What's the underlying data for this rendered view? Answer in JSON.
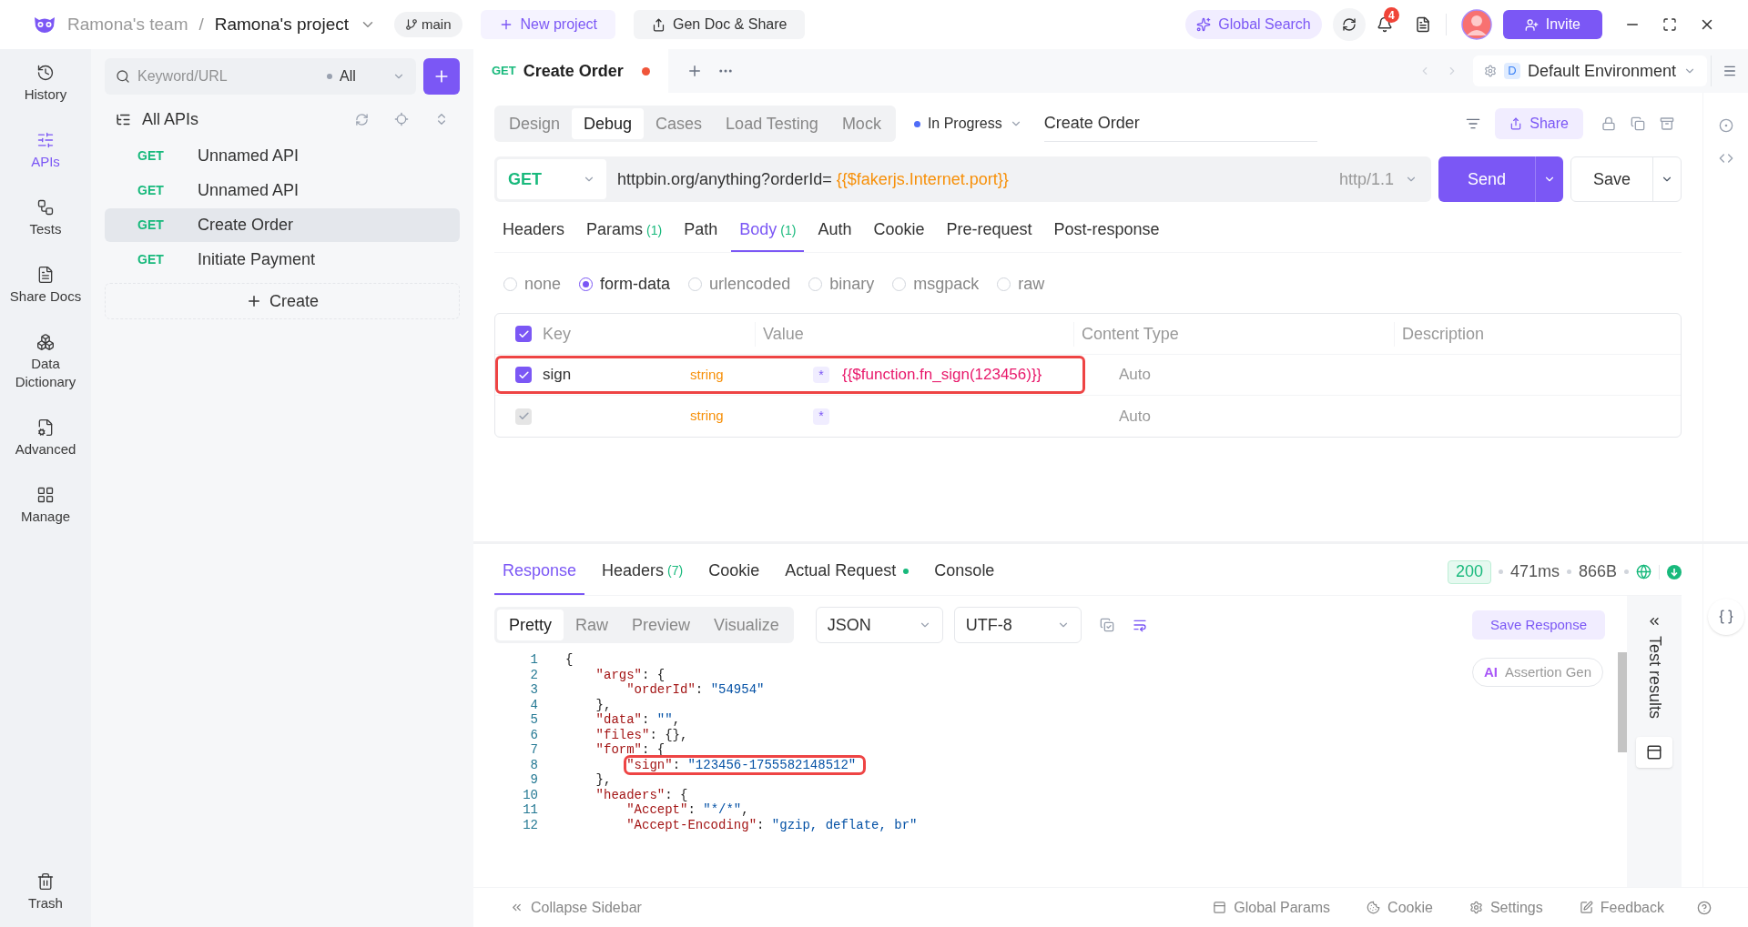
{
  "topbar": {
    "team": "Ramona's team",
    "separator": "/",
    "project": "Ramona's project",
    "branch": "main",
    "new_project": "New project",
    "gen_doc": "Gen Doc & Share",
    "global_search": "Global Search",
    "notifications": "4",
    "invite": "Invite"
  },
  "nav": [
    {
      "label": "History",
      "selected": false
    },
    {
      "label": "APIs",
      "selected": true
    },
    {
      "label": "Tests",
      "selected": false
    },
    {
      "label": "Share Docs",
      "selected": false
    },
    {
      "label": "Data Dictionary",
      "selected": false
    },
    {
      "label": "Advanced",
      "selected": false
    },
    {
      "label": "Manage",
      "selected": false
    },
    {
      "label": "Trash",
      "selected": false
    }
  ],
  "api_list": {
    "search_placeholder": "Keyword/URL",
    "filter": "All",
    "title": "All APIs",
    "create": "Create",
    "items": [
      {
        "method": "GET",
        "name": "Unnamed API",
        "selected": false
      },
      {
        "method": "GET",
        "name": "Unnamed API",
        "selected": false
      },
      {
        "method": "GET",
        "name": "Create Order",
        "selected": true
      },
      {
        "method": "GET",
        "name": "Initiate Payment",
        "selected": false
      }
    ]
  },
  "tab": {
    "method": "GET",
    "title": "Create Order",
    "unsaved": true
  },
  "environment": {
    "badge": "D",
    "name": "Default Environment"
  },
  "mode_tabs": [
    {
      "label": "Design",
      "selected": false
    },
    {
      "label": "Debug",
      "selected": true
    },
    {
      "label": "Cases",
      "selected": false
    },
    {
      "label": "Load Testing",
      "selected": false
    },
    {
      "label": "Mock",
      "selected": false
    }
  ],
  "status": "In Progress",
  "name_field": "Create Order",
  "share": "Share",
  "request": {
    "method": "GET",
    "url": "httpbin.org/anything?orderId= ",
    "url_variable": "{{$fakerjs.Internet.port}}",
    "protocol": "http/1.1",
    "send": "Send",
    "save": "Save"
  },
  "param_tabs": [
    {
      "label": "Headers",
      "selected": false
    },
    {
      "label": "Params",
      "count": "(1)",
      "selected": false
    },
    {
      "label": "Path",
      "selected": false
    },
    {
      "label": "Body",
      "count": "(1)",
      "selected": true
    },
    {
      "label": "Auth",
      "selected": false
    },
    {
      "label": "Cookie",
      "selected": false
    },
    {
      "label": "Pre-request",
      "selected": false
    },
    {
      "label": "Post-response",
      "selected": false
    }
  ],
  "body_types": [
    {
      "label": "none",
      "selected": false
    },
    {
      "label": "form-data",
      "selected": true
    },
    {
      "label": "urlencoded",
      "selected": false
    },
    {
      "label": "binary",
      "selected": false
    },
    {
      "label": "msgpack",
      "selected": false
    },
    {
      "label": "raw",
      "selected": false
    }
  ],
  "body_table": {
    "columns": [
      "Key",
      "Value",
      "Content Type",
      "Description"
    ],
    "all_checked": true,
    "rows": [
      {
        "checked": true,
        "disabled": false,
        "key": "sign",
        "type": "string",
        "required": "*",
        "value": "{{$function.fn_sign(123456)}}",
        "content_type": "Auto",
        "highlighted": true
      },
      {
        "checked": true,
        "disabled": true,
        "type": "string",
        "required": "*",
        "content_type": "Auto",
        "highlighted": false
      }
    ]
  },
  "response": {
    "tabs": [
      {
        "label": "Response",
        "selected": true,
        "dot": false
      },
      {
        "label": "Headers",
        "count": "(7)",
        "selected": false,
        "dot": false
      },
      {
        "label": "Cookie",
        "selected": false,
        "dot": false
      },
      {
        "label": "Actual Request",
        "selected": false,
        "dot": true
      },
      {
        "label": "Console",
        "selected": false,
        "dot": false
      }
    ],
    "status_code": "200",
    "time": "471ms",
    "size": "866B",
    "view_tabs": [
      {
        "label": "Pretty",
        "selected": true
      },
      {
        "label": "Raw",
        "selected": false
      },
      {
        "label": "Preview",
        "selected": false
      },
      {
        "label": "Visualize",
        "selected": false
      }
    ],
    "format": "JSON",
    "encoding": "UTF-8",
    "save_response": "Save Response",
    "ai_badge": "AI",
    "assertion_gen": "Assertion Gen",
    "test_results": "Test results",
    "code_lines": [
      {
        "n": "1",
        "highlighted": false,
        "parts": [
          {
            "kind": "punct",
            "text": "{"
          }
        ]
      },
      {
        "n": "2",
        "highlighted": false,
        "parts": [
          {
            "kind": "key",
            "text": "\"args\""
          },
          {
            "kind": "punct",
            "text": ": {"
          }
        ]
      },
      {
        "n": "3",
        "highlighted": false,
        "parts": [
          {
            "kind": "key",
            "text": "\"orderId\""
          },
          {
            "kind": "punct",
            "text": ": "
          },
          {
            "kind": "str",
            "text": "\"54954\""
          }
        ]
      },
      {
        "n": "4",
        "highlighted": false,
        "parts": [
          {
            "kind": "punct",
            "text": "},"
          }
        ]
      },
      {
        "n": "5",
        "highlighted": false,
        "parts": [
          {
            "kind": "key",
            "text": "\"data\""
          },
          {
            "kind": "punct",
            "text": ": "
          },
          {
            "kind": "str",
            "text": "\"\""
          },
          {
            "kind": "punct",
            "text": ","
          }
        ]
      },
      {
        "n": "6",
        "highlighted": false,
        "parts": [
          {
            "kind": "key",
            "text": "\"files\""
          },
          {
            "kind": "punct",
            "text": ": {},"
          }
        ]
      },
      {
        "n": "7",
        "highlighted": false,
        "parts": [
          {
            "kind": "key",
            "text": "\"form\""
          },
          {
            "kind": "punct",
            "text": ": {"
          }
        ]
      },
      {
        "n": "8",
        "highlighted": true,
        "parts": [
          {
            "kind": "key",
            "text": "\"sign\""
          },
          {
            "kind": "punct",
            "text": ": "
          },
          {
            "kind": "str",
            "text": "\"123456-1755582148512\""
          }
        ]
      },
      {
        "n": "9",
        "highlighted": false,
        "parts": [
          {
            "kind": "punct",
            "text": "},"
          }
        ]
      },
      {
        "n": "10",
        "highlighted": false,
        "parts": [
          {
            "kind": "key",
            "text": "\"headers\""
          },
          {
            "kind": "punct",
            "text": ": {"
          }
        ]
      },
      {
        "n": "11",
        "highlighted": false,
        "parts": [
          {
            "kind": "key",
            "text": "\"Accept\""
          },
          {
            "kind": "punct",
            "text": ": "
          },
          {
            "kind": "str",
            "text": "\"*/*\""
          },
          {
            "kind": "punct",
            "text": ","
          }
        ]
      },
      {
        "n": "12",
        "highlighted": false,
        "parts": [
          {
            "kind": "key",
            "text": "\"Accept-Encoding\""
          },
          {
            "kind": "punct",
            "text": ": "
          },
          {
            "kind": "str",
            "text": "\"gzip, deflate, br\""
          }
        ]
      }
    ]
  },
  "footer": [
    {
      "kind": "collapse",
      "label": "Collapse Sidebar"
    },
    {
      "kind": "params",
      "label": "Global Params"
    },
    {
      "kind": "cookie",
      "label": "Cookie"
    },
    {
      "kind": "settings",
      "label": "Settings"
    },
    {
      "kind": "feedback",
      "label": "Feedback"
    },
    {
      "kind": "help"
    }
  ]
}
